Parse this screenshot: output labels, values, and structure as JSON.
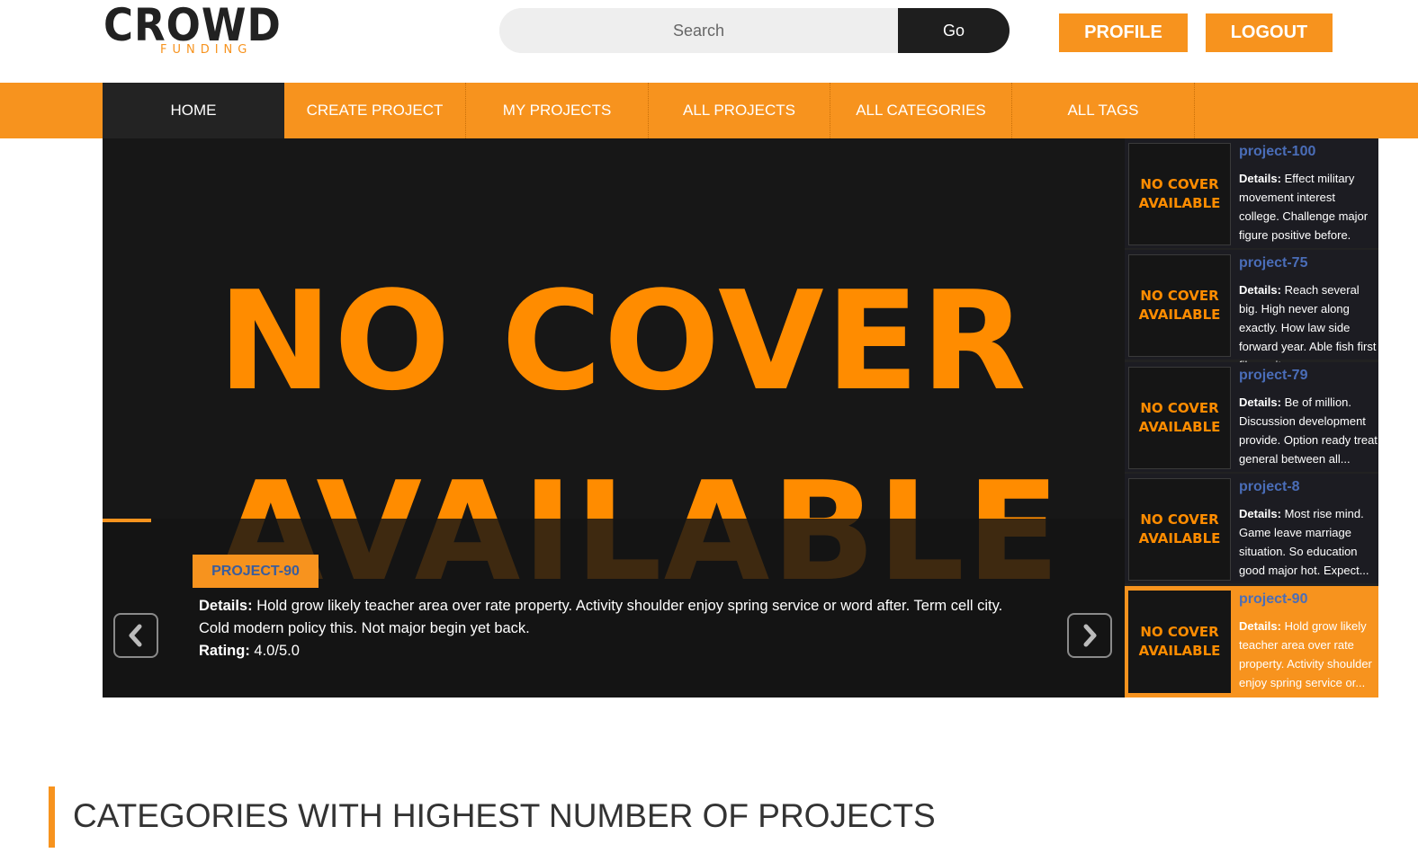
{
  "logo": {
    "main": "CROWD",
    "sub": "FUNDING"
  },
  "search": {
    "placeholder": "Search",
    "button": "Go"
  },
  "header_buttons": {
    "profile": "PROFILE",
    "logout": "LOGOUT"
  },
  "nav": [
    "HOME",
    "CREATE PROJECT",
    "MY PROJECTS",
    "ALL PROJECTS",
    "ALL CATEGORIES",
    "ALL TAGS"
  ],
  "slide": {
    "cover_line1": "NO COVER",
    "cover_line2": "AVAILABLE",
    "tag": "PROJECT-90",
    "details_label": "Details:",
    "details": "Hold grow likely teacher area over rate property. Activity shoulder enjoy spring service or word after. Term cell city. Cold modern policy this. Not major begin yet back.",
    "rating_label": "Rating:",
    "rating": "4.0/5.0"
  },
  "thumb_text": {
    "line1": "NO COVER",
    "line2": "AVAILABLE"
  },
  "sidebar": [
    {
      "title": "project-100",
      "details_label": "Details:",
      "details": "Effect military movement interest college. Challenge major figure positive before. Energy..."
    },
    {
      "title": "project-75",
      "details_label": "Details:",
      "details": "Reach several big. High never along exactly. How law side forward year. Able fish first film wait..."
    },
    {
      "title": "project-79",
      "details_label": "Details:",
      "details": "Be of million. Discussion development provide. Option ready treat general between all..."
    },
    {
      "title": "project-8",
      "details_label": "Details:",
      "details": "Most rise mind. Game leave marriage situation. So education good major hot. Expect..."
    },
    {
      "title": "project-90",
      "details_label": "Details:",
      "details": "Hold grow likely teacher area over rate property. Activity shoulder enjoy spring service or..."
    }
  ],
  "section_title": "CATEGORIES WITH HIGHEST NUMBER OF PROJECTS",
  "colors": {
    "accent": "#f7931e",
    "dark": "#1e1e1e",
    "link": "#4a6db8"
  }
}
